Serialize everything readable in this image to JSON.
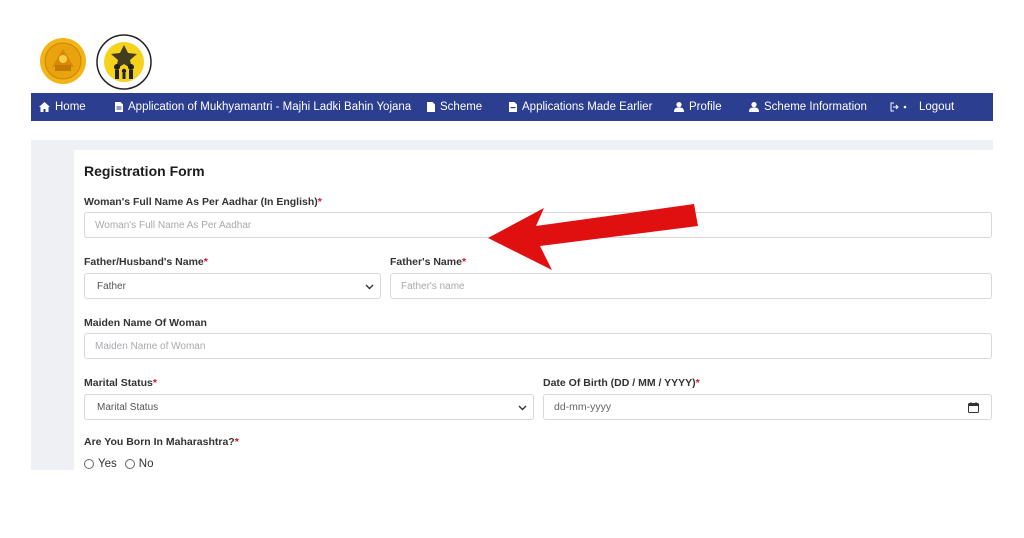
{
  "logos": {
    "maharashtra_seal": "maharashtra-govt-seal",
    "wcd": "women-child-development-logo"
  },
  "nav": {
    "items": [
      {
        "label": "Home",
        "icon": "home-icon"
      },
      {
        "label": "Application of Mukhyamantri - Majhi Ladki Bahin Yojana",
        "icon": "document-icon"
      },
      {
        "label": "Scheme",
        "icon": "document-icon"
      },
      {
        "label": "Applications Made Earlier",
        "icon": "document-icon"
      },
      {
        "label": "Profile",
        "icon": "user-icon"
      },
      {
        "label": "Scheme Information",
        "icon": "user-icon"
      },
      {
        "label": "Logout",
        "icon": "logout-icon"
      }
    ]
  },
  "form": {
    "title": "Registration Form",
    "full_name": {
      "label": "Woman's Full Name As Per Aadhar (In English)",
      "required": "*",
      "placeholder": "Woman's Full Name As Per Aadhar"
    },
    "guardian_type": {
      "label": "Father/Husband's Name",
      "required": "*",
      "selected": "Father"
    },
    "father_name": {
      "label": "Father's Name",
      "required": "*",
      "placeholder": "Father's name"
    },
    "maiden_name": {
      "label": "Maiden Name Of Woman",
      "placeholder": "Maiden Name of Woman"
    },
    "marital_status": {
      "label": "Marital Status",
      "required": "*",
      "selected": "Marital Status"
    },
    "dob": {
      "label": "Date Of Birth (DD / MM / YYYY)",
      "required": "*",
      "placeholder": "dd-mm-yyyy"
    },
    "born_in_maharashtra": {
      "label": "Are You Born In Maharashtra?",
      "required": "*",
      "options": [
        "Yes",
        "No"
      ]
    }
  },
  "annotation": {
    "arrow_color": "#e01010"
  },
  "colors": {
    "navbar": "#2b3e8f",
    "required": "#d0142c"
  }
}
